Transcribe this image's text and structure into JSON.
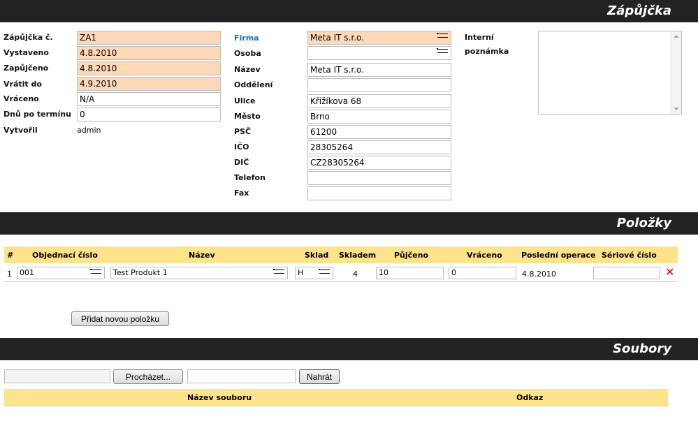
{
  "sections": {
    "zapujcka": "Zápůjčka",
    "polozky": "Položky",
    "soubory": "Soubory"
  },
  "loan": {
    "cislo_label": "Zápůjčka č.",
    "cislo": "ZA1",
    "vystaveno_label": "Vystaveno",
    "vystaveno": "4.8.2010",
    "zapujceno_label": "Zapůjčeno",
    "zapujceno": "4.8.2010",
    "vratit_label": "Vrátit do",
    "vratit": "4.9.2010",
    "vraceno_label": "Vráceno",
    "vraceno": "N/A",
    "dnu_label": "Dnů po termínu",
    "dnu": "0",
    "vytvoril_label": "Vytvořil",
    "vytvoril": "admin"
  },
  "company": {
    "firma_label": "Firma",
    "firma": "Meta IT s.r.o.",
    "osoba_label": "Osoba",
    "osoba": "",
    "nazev_label": "Název",
    "nazev": "Meta IT s.r.o.",
    "oddeleni_label": "Oddělení",
    "oddeleni": "",
    "ulice_label": "Ulice",
    "ulice": "Křižíkova 68",
    "mesto_label": "Město",
    "mesto": "Brno",
    "psc_label": "PSČ",
    "psc": "61200",
    "ico_label": "IČO",
    "ico": "28305264",
    "dic_label": "DIČ",
    "dic": "CZ28305264",
    "telefon_label": "Telefon",
    "telefon": "",
    "fax_label": "Fax",
    "fax": ""
  },
  "note": {
    "label_line1": "Interní",
    "label_line2": "poznámka",
    "value": ""
  },
  "items_table": {
    "headers": [
      "#",
      "Objednací číslo",
      "Název",
      "Sklad",
      "Skladem",
      "Půjčeno",
      "Vráceno",
      "Poslední operace",
      "Sériové číslo"
    ],
    "rows": [
      {
        "num": "1",
        "order_no": "001",
        "name": "Test Produkt 1",
        "sklad": "H",
        "skladem": "4",
        "pujceno": "10",
        "vraceno": "0",
        "last_op": "4.8.2010",
        "serial": ""
      }
    ],
    "add_button": "Přidat novou položku"
  },
  "files": {
    "browse_button": "Procházet...",
    "upload_button": "Nahrát",
    "headers": [
      "Název souboru",
      "Odkaz"
    ]
  },
  "colors": {
    "highlight": "#fdd9b9",
    "table_header": "#fde48c",
    "section_bar": "#222222",
    "link_blue": "#1a6fc0",
    "delete_red": "#dd0000"
  }
}
